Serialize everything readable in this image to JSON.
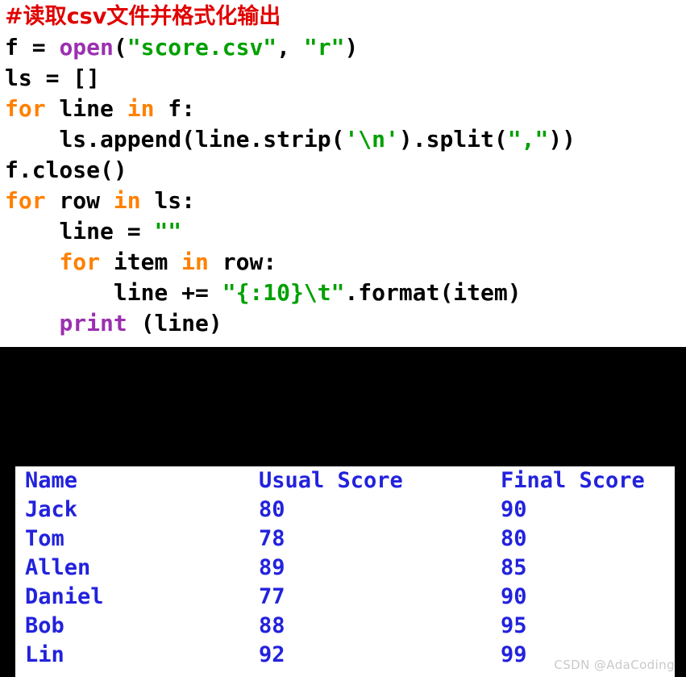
{
  "editor": {
    "comment": "#读取csv文件并格式化输出",
    "lines": [
      {
        "indent": "",
        "tokens": [
          {
            "t": "f = ",
            "k": "plain"
          },
          {
            "t": "open",
            "k": "builtin"
          },
          {
            "t": "(",
            "k": "plain"
          },
          {
            "t": "\"score.csv\"",
            "k": "string"
          },
          {
            "t": ", ",
            "k": "plain"
          },
          {
            "t": "\"r\"",
            "k": "string"
          },
          {
            "t": ")",
            "k": "plain"
          }
        ]
      },
      {
        "indent": "",
        "tokens": [
          {
            "t": "ls = []",
            "k": "plain"
          }
        ]
      },
      {
        "indent": "",
        "tokens": [
          {
            "t": "for",
            "k": "keyword"
          },
          {
            "t": " line ",
            "k": "plain"
          },
          {
            "t": "in",
            "k": "keyword"
          },
          {
            "t": " f:",
            "k": "plain"
          }
        ]
      },
      {
        "indent": "    ",
        "tokens": [
          {
            "t": "ls.append(line.strip(",
            "k": "plain"
          },
          {
            "t": "'\\n'",
            "k": "string"
          },
          {
            "t": ").split(",
            "k": "plain"
          },
          {
            "t": "\",\"",
            "k": "string"
          },
          {
            "t": "))",
            "k": "plain"
          }
        ]
      },
      {
        "indent": "",
        "tokens": [
          {
            "t": "f.close()",
            "k": "plain"
          }
        ]
      },
      {
        "indent": "",
        "tokens": [
          {
            "t": "for",
            "k": "keyword"
          },
          {
            "t": " row ",
            "k": "plain"
          },
          {
            "t": "in",
            "k": "keyword"
          },
          {
            "t": " ls:",
            "k": "plain"
          }
        ]
      },
      {
        "indent": "    ",
        "tokens": [
          {
            "t": "line = ",
            "k": "plain"
          },
          {
            "t": "\"\"",
            "k": "string"
          }
        ]
      },
      {
        "indent": "    ",
        "tokens": [
          {
            "t": "for",
            "k": "keyword"
          },
          {
            "t": " item ",
            "k": "plain"
          },
          {
            "t": "in",
            "k": "keyword"
          },
          {
            "t": " row:",
            "k": "plain"
          }
        ]
      },
      {
        "indent": "        ",
        "tokens": [
          {
            "t": "line += ",
            "k": "plain"
          },
          {
            "t": "\"{:10}\\t\"",
            "k": "string"
          },
          {
            "t": ".format(item)",
            "k": "plain"
          }
        ]
      },
      {
        "indent": "    ",
        "tokens": [
          {
            "t": "print",
            "k": "builtin"
          },
          {
            "t": " (line)",
            "k": "plain"
          }
        ]
      }
    ]
  },
  "console": {
    "table": {
      "headers": [
        "Name",
        "Usual Score",
        "Final Score"
      ],
      "rows": [
        [
          "Jack",
          "80",
          "90"
        ],
        [
          "Tom",
          "78",
          "80"
        ],
        [
          "Allen",
          "89",
          "85"
        ],
        [
          "Daniel",
          "77",
          "90"
        ],
        [
          "Bob",
          "88",
          "95"
        ],
        [
          "Lin",
          "92",
          "99"
        ]
      ]
    }
  },
  "watermark": {
    "text": "CSDN @AdaCoding"
  },
  "colors": {
    "comment": "#e00000",
    "keyword": "#ff8000",
    "builtin": "#9b30b0",
    "string": "#00a000",
    "plain": "#000000",
    "console_bg": "#000000",
    "table_bg": "#ffffff",
    "table_text": "#2222dd",
    "watermark": "#c9c9c9"
  }
}
